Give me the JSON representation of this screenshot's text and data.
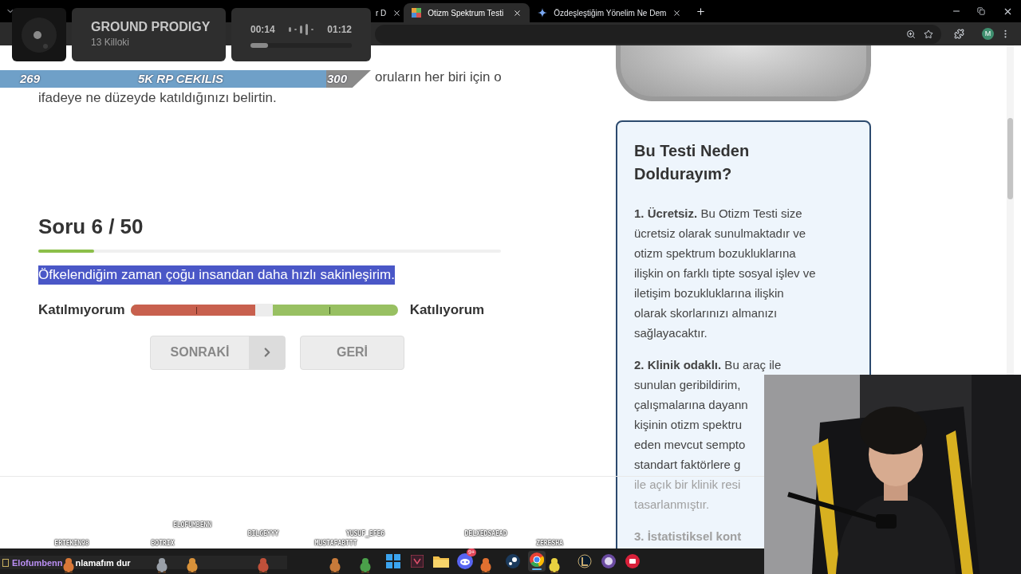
{
  "browser": {
    "tabs": [
      {
        "title": "r D",
        "selected": false
      },
      {
        "title": "Otizm Spektrum Testi",
        "selected": true
      },
      {
        "title": "Özdeşleştiğim Yönelim Ne Dem",
        "selected": false
      }
    ],
    "profile_initial": "M"
  },
  "page": {
    "intro_lines": [
      "oruların her biri için o",
      "ifadeye ne düzeyde katıldığınızı belirtin."
    ],
    "question_heading": "Soru 6 / 50",
    "progress": {
      "level": 0.12
    },
    "question": {
      "text": "Öfkelendiğim zaman çoğu insandan daha hızlı sakinleşirim.",
      "selected": true
    },
    "scale": {
      "left_label": "Katılmıyorum",
      "right_label": "Katılıyorum",
      "level": 0.5
    },
    "buttons": [
      {
        "label": "SONRAKİ",
        "kind": "next"
      },
      {
        "label": "GERİ",
        "kind": "plain"
      }
    ]
  },
  "sidebar_card": {
    "title_lines": [
      "Bu Testi Neden",
      "Doldurayım?"
    ],
    "paragraphs": [
      {
        "lines": [
          {
            "text": "**1. Ücretsiz.** Bu Otizm Testi size",
            "faded": false
          },
          {
            "text": "ücretsiz olarak sunulmaktadır ve",
            "faded": false
          },
          {
            "text": "otizm spektrum bozukluklarına",
            "faded": false
          },
          {
            "text": "ilişkin on farklı tipte sosyal işlev ve",
            "faded": false
          },
          {
            "text": "iletişim bozukluklarına ilişkin",
            "faded": false
          },
          {
            "text": "olarak skorlarınızı almanızı",
            "faded": false
          },
          {
            "text": "sağlayacaktır.",
            "faded": false
          }
        ]
      },
      {
        "lines": [
          {
            "text": "**2. Klinik odaklı.** Bu araç ile",
            "faded": false
          },
          {
            "text": "sunulan geribildirim,",
            "faded": false
          },
          {
            "text": "çalışmalarına dayann",
            "faded": false
          },
          {
            "text": "kişinin otizm spektru",
            "faded": false
          },
          {
            "text": "eden mevcut sempto",
            "faded": false
          },
          {
            "text": "standart faktörlere g",
            "faded": false
          },
          {
            "text": "ile açık bir klinik resi",
            "faded": true
          },
          {
            "text": "tasarlanmıştır.",
            "faded": true
          }
        ]
      },
      {
        "lines": [
          {
            "text": "3. İstatistiksel kont",
            "faded": true,
            "bold": true
          }
        ]
      }
    ]
  },
  "stream_overlay": {
    "now_playing": {
      "title": "GROUND PRODIGY",
      "artist": "13 Killoki",
      "elapsed": "00:14",
      "duration": "01:12",
      "level": 0.17
    },
    "goal_banner": {
      "current": "269",
      "title": "5K RP CEKILIS",
      "target": "300"
    },
    "chat": {
      "user": "Elofumbenn",
      "message": "nlamafım dur"
    },
    "viewers": [
      {
        "name": "ELOFUMBENN"
      },
      {
        "name": "BILGEYYY"
      },
      {
        "name": "YUSUF_EFE6"
      },
      {
        "name": "DELXEDSAEAD"
      },
      {
        "name": "ERTEKIN98"
      },
      {
        "name": "BOTRIX"
      },
      {
        "name": "MUSTAFABTTT"
      },
      {
        "name": "ZERESHA"
      }
    ]
  },
  "taskbar": {
    "notification_badge": "9+"
  }
}
